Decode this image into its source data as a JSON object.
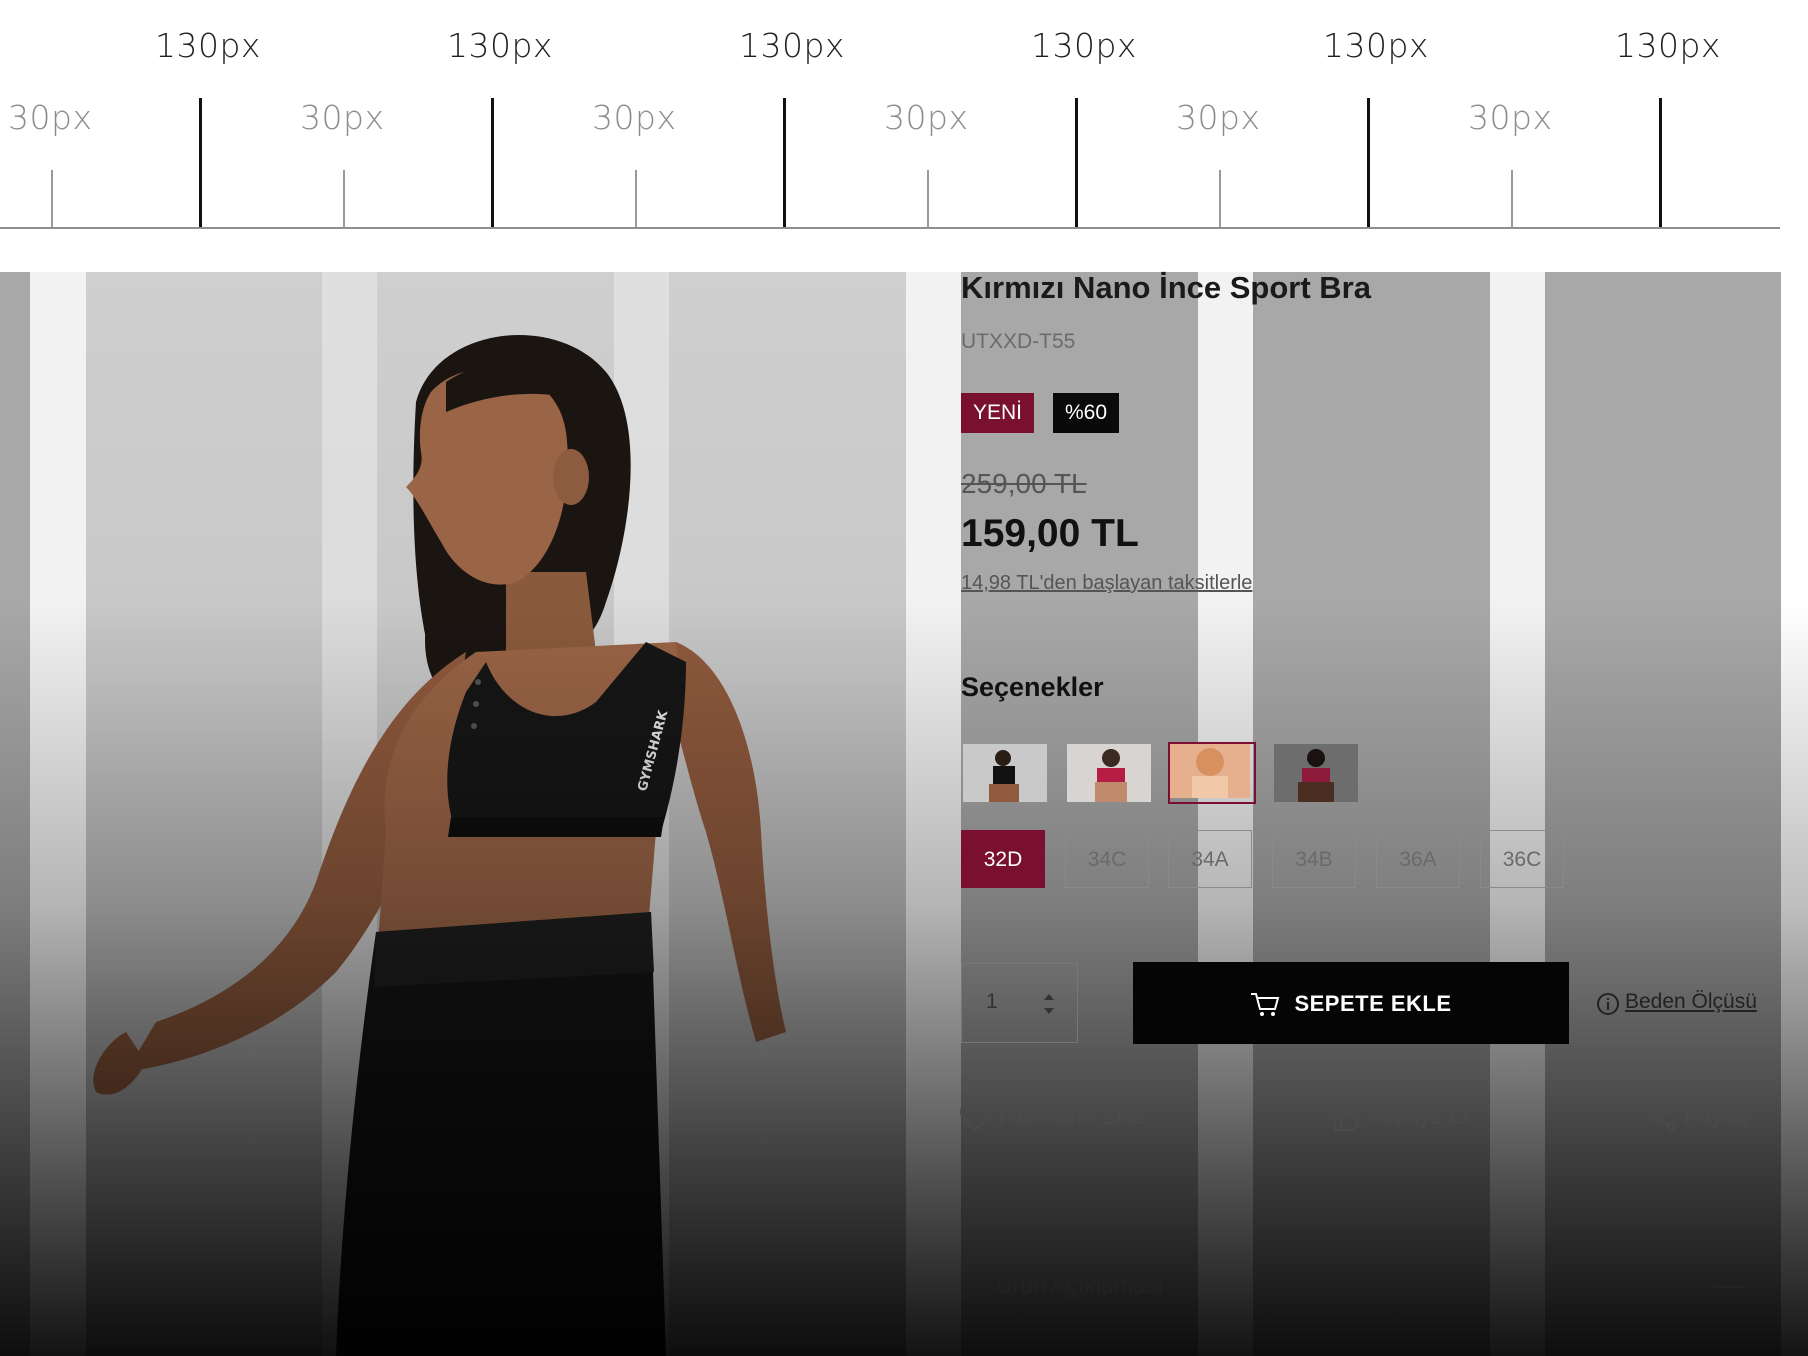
{
  "ruler": {
    "column_label": "130px",
    "gutter_label": "30px",
    "column_count": 6,
    "gutter_count": 6
  },
  "product": {
    "title": "Kırmızı Nano İnce Sport Bra",
    "sku": "UTXXD-T55",
    "badges": {
      "new": "YENİ",
      "discount": "%60"
    },
    "old_price": "259,00 TL",
    "price": "159,00 TL",
    "installments": "14,98 TL'den başlayan taksitlerle",
    "photo_brand_text": "GYMSHARK"
  },
  "options": {
    "title": "Seçenekler",
    "variants": [
      "black-bra-variant",
      "pink-top-variant",
      "peach-top-variant",
      "dark-red-variant"
    ],
    "selected_variant_index": 2,
    "sizes": [
      "32D",
      "34C",
      "34A",
      "34B",
      "36A",
      "36C"
    ],
    "selected_size": "32D"
  },
  "purchase": {
    "quantity": "1",
    "add_to_cart": "SEPETE EKLE",
    "size_guide": "Beden Ölçüsü"
  },
  "actions": {
    "favorite": "Favorilere Ekle",
    "recommend": "Tavsiye Et",
    "share": "Paylaş"
  },
  "description": {
    "title": "Ürün Açıklaması"
  },
  "colors": {
    "accent": "#7a1030",
    "button": "#050505",
    "grid_column": "#a8a8a8",
    "grid_gutter": "#f2f2f2"
  }
}
